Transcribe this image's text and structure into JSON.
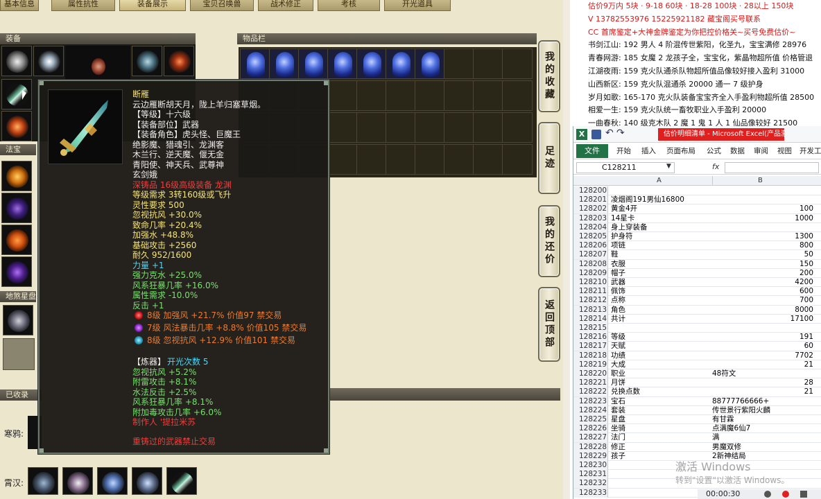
{
  "top_tabs": [
    "基本信息",
    "属性抗性",
    "装备展示",
    "宝贝召唤兽",
    "战术修正",
    "考核",
    "开光道具"
  ],
  "sections": {
    "equipment": "装备",
    "items": "物品栏",
    "fabao": "法宝",
    "xingpan": "地煞星盘",
    "collected": "已收录"
  },
  "side_nav": [
    "我的收藏",
    "足迹",
    "我的还价",
    "返回顶部"
  ],
  "player_labels": [
    "寒鸦:",
    "霄汉:"
  ],
  "tooltip": {
    "name": "断雁",
    "desc": "云边雁断胡天月，陇上羊归塞草烟。",
    "level": "【等级】十六级",
    "slot": "【装备部位】武器",
    "roles1": "【装备角色】虎头怪、巨魔王",
    "roles2": "绝影魔、猎魂引、龙渊客",
    "roles3": "木兰行、逆天魔、偃无金",
    "roles4": "青阳使、神天兵、武尊神",
    "roles5": "玄剑娥",
    "quality": "深铸品 16级高级装备 龙渊",
    "req": "等级需求 3转160级或飞升",
    "spirit": "灵性要求 500",
    "stat1": "忽视抗风 +30.0%",
    "stat2": "致命几率 +20.4%",
    "stat3": "加强水 +48.8%",
    "stat4": "基础攻击 +2560",
    "durability": "耐久 952/1600",
    "power": "力量 +1",
    "g1": "强力克水 +25.0%",
    "g2": "风系狂暴几率 +16.0%",
    "g3": "属性需求 -10.0%",
    "g4": "反击 +1",
    "gem1": "8级 加强风 +21.7% 价值97 禁交易",
    "gem2": "7级 风法暴击几率 +8.8% 价值105 禁交易",
    "gem3": "8级 忽视抗风 +12.9% 价值101 禁交易",
    "lq_title": "【炼器】",
    "lq_open": "开光次数 5",
    "lq1": "忽视抗风 +5.2%",
    "lq2": "附雷攻击 +8.1%",
    "lq3": "水法反击 +2.5%",
    "lq4": "风系狂暴几率 +8.1%",
    "lq5": "附加毒攻击几率 +6.0%",
    "maker": "制作人 '提拉米苏",
    "lock": "重铸过的武器禁止交易"
  },
  "listings": [
    {
      "text": "估价9万内 5块 · 9-18 60块 · 18-28 100块 · 28以上 150块",
      "color": "#d81a1a"
    },
    {
      "text": "V 13782553976    15225921182    藏宝阁买号联系",
      "color": "#d81a1a"
    },
    {
      "text": "CC 首席鉴定+大神金牌鉴定为你把控价格关~买号免费估价~",
      "color": "#d81a1a"
    },
    {
      "text": "书剑江山: 192 男人 4 阶混传世紫阳，化圣九，宝宝满修 28976",
      "color": "#111"
    },
    {
      "text": "青春网游: 185 女魔 2 龙孩子全，宝宝化，紫晶物超所值 价格管退",
      "color": "#111"
    },
    {
      "text": "江湖夜雨: 159 克火队通杀队物超所值品像较好接入盈利 31000",
      "color": "#111"
    },
    {
      "text": "山西新区: 159 克火队混通杀 20000 通一 7 级护身",
      "color": "#111"
    },
    {
      "text": "岁月如歌: 165-170 克火队装备宝宝齐全入手盈利物超所值 28500",
      "color": "#111"
    },
    {
      "text": "相爱一生: 159 克火队统一畜牧职业入手盈利 20000",
      "color": "#111"
    },
    {
      "text": "一曲春秋: 140 级克木队 2 魔 1 鬼 1 人 1 仙品像较好 21500",
      "color": "#111"
    }
  ],
  "excel": {
    "title": "估价明细清单 - Microsoft Excel(产品激...",
    "ribbon": [
      "文件",
      "开始",
      "插入",
      "页面布局",
      "公式",
      "数据",
      "审阅",
      "视图",
      "开发工"
    ],
    "namebox": "C128211",
    "fx": "fx",
    "col_a": "A",
    "col_b": "B",
    "rows": [
      [
        "128200",
        "",
        ""
      ],
      [
        "128201",
        "凌烟阁191男仙16800",
        ""
      ],
      [
        "128202",
        "黄金4开",
        "100"
      ],
      [
        "128203",
        "14星卡",
        "1000"
      ],
      [
        "128204",
        "身上穿装备",
        ""
      ],
      [
        "128205",
        "护身符",
        "1300"
      ],
      [
        "128206",
        "项链",
        "800"
      ],
      [
        "128207",
        "鞋",
        "50"
      ],
      [
        "128208",
        "衣服",
        "150"
      ],
      [
        "128209",
        "帽子",
        "200"
      ],
      [
        "128210",
        "武器",
        "4200"
      ],
      [
        "128211",
        "佩饰",
        "600"
      ],
      [
        "128212",
        "点称",
        "700"
      ],
      [
        "128213",
        "角色",
        "8000"
      ],
      [
        "128214",
        "共计",
        "17100"
      ],
      [
        "128215",
        "",
        ""
      ],
      [
        "128216",
        "等级",
        "191"
      ],
      [
        "128217",
        "天赋",
        "60"
      ],
      [
        "128218",
        "功绩",
        "7702"
      ],
      [
        "128219",
        "大成",
        "21"
      ],
      [
        "128220",
        "职业",
        "48符文"
      ],
      [
        "128221",
        "月饼",
        "28"
      ],
      [
        "128222",
        "兑换点数",
        "21"
      ],
      [
        "128223",
        "宝石",
        "88777766666+"
      ],
      [
        "128224",
        "套装",
        "传世景行紫阳火麟"
      ],
      [
        "128225",
        "星盘",
        "有甘霖"
      ],
      [
        "128226",
        "坐骑",
        "点满魔6仙7"
      ],
      [
        "128227",
        "法门",
        "满"
      ],
      [
        "128228",
        "修正",
        "男魔双修"
      ],
      [
        "128229",
        "孩子",
        "2新神结局"
      ],
      [
        "128230",
        "",
        ""
      ],
      [
        "128231",
        "",
        ""
      ],
      [
        "128232",
        "",
        ""
      ],
      [
        "128233",
        "",
        ""
      ]
    ]
  },
  "watermark1": "激活 Windows",
  "watermark2": "转到\"设置\"以激活 Windows。",
  "timer": "00:00:30",
  "colors": {
    "accent_red": "#d81a1a",
    "excel_green": "#217346",
    "tooltip_yellow": "#f4e37a",
    "tooltip_green": "#79e06f"
  }
}
